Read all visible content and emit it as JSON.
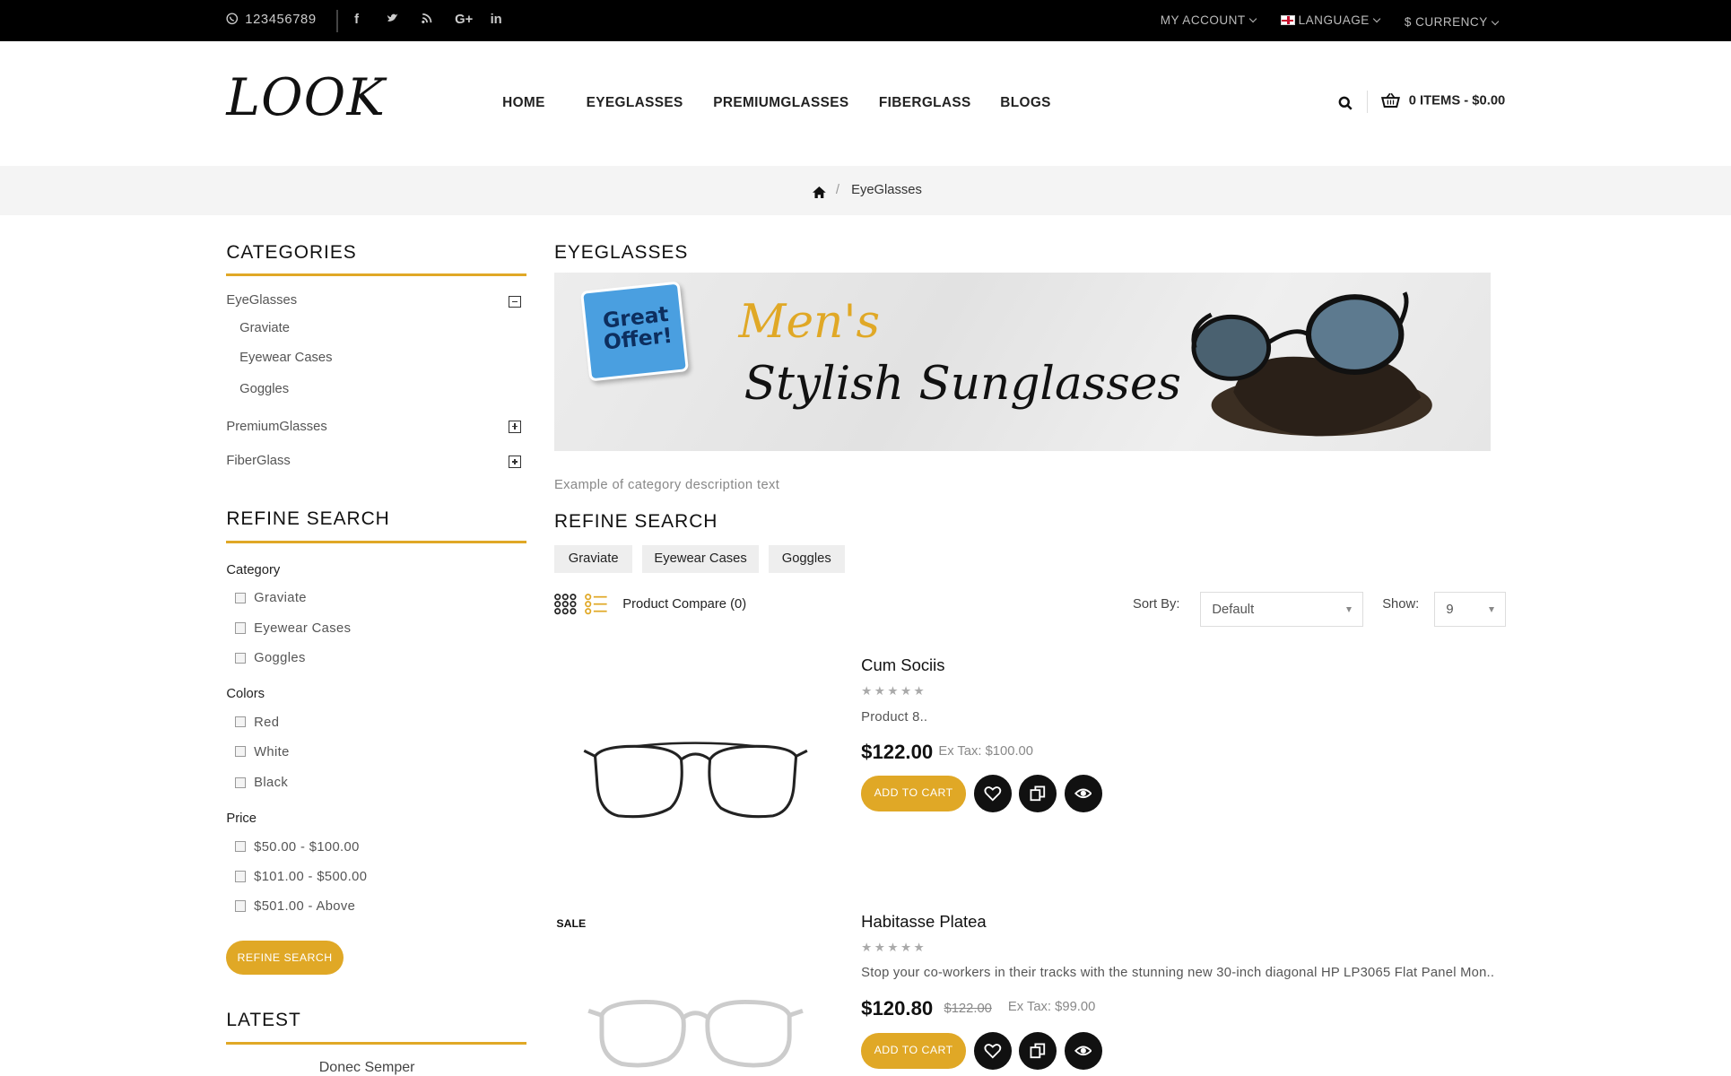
{
  "topbar": {
    "phone": "123456789",
    "social": [
      "f",
      "t",
      "rss",
      "G+",
      "in"
    ],
    "account": "MY ACCOUNT",
    "language": "LANGUAGE",
    "currency": "$ CURRENCY"
  },
  "header": {
    "logo": "LOOK",
    "nav": [
      "HOME",
      "EYEGLASSES",
      "PREMIUMGLASSES",
      "FIBERGLASS",
      "BLOGS"
    ],
    "cart": "0 ITEMS - $0.00"
  },
  "breadcrumb": {
    "current": "EyeGlasses"
  },
  "sidebar": {
    "categories_title": "CATEGORIES",
    "categories": [
      {
        "label": "EyeGlasses",
        "expanded": true,
        "children": [
          "Graviate",
          "Eyewear Cases",
          "Goggles"
        ]
      },
      {
        "label": "PremiumGlasses",
        "expanded": false
      },
      {
        "label": "FiberGlass",
        "expanded": false
      }
    ],
    "refine_title": "REFINE SEARCH",
    "filters": [
      {
        "label": "Category",
        "options": [
          "Graviate",
          "Eyewear Cases",
          "Goggles"
        ]
      },
      {
        "label": "Colors",
        "options": [
          "Red",
          "White",
          "Black"
        ]
      },
      {
        "label": "Price",
        "options": [
          "$50.00 - $100.00",
          "$101.00 - $500.00",
          "$501.00 - Above"
        ]
      }
    ],
    "refine_button": "REFINE SEARCH",
    "latest_title": "LATEST",
    "latest_item": "Donec Semper"
  },
  "main": {
    "title": "EYEGLASSES",
    "banner": {
      "sticker": "Great Offer!",
      "line1": "Men's",
      "line2": "Stylish Sunglasses"
    },
    "description": "Example of category description text",
    "refine_title": "REFINE SEARCH",
    "refine_tags": [
      "Graviate",
      "Eyewear Cases",
      "Goggles"
    ],
    "compare": "Product Compare (0)",
    "sort_label": "Sort By:",
    "sort_value": "Default",
    "show_label": "Show:",
    "show_value": "9",
    "products": [
      {
        "name": "Cum Sociis",
        "stars": "★★★★★",
        "description": "Product 8..",
        "price": "$122.00",
        "old_price": "",
        "ex_tax": "Ex Tax: $100.00",
        "add_to_cart": "ADD TO CART",
        "badge": ""
      },
      {
        "name": "Habitasse Platea",
        "stars": "★★★★★",
        "description": "Stop your co-workers in their tracks with the stunning new 30-inch diagonal HP LP3065 Flat Panel Mon..",
        "price": "$120.80",
        "old_price": "$122.00",
        "ex_tax": "Ex Tax: $99.00",
        "add_to_cart": "ADD TO CART",
        "badge": "SALE"
      }
    ]
  },
  "colors": {
    "accent": "#e0a826",
    "topbar": "#000000",
    "breadcrumb_bg": "#f4f4f4"
  }
}
